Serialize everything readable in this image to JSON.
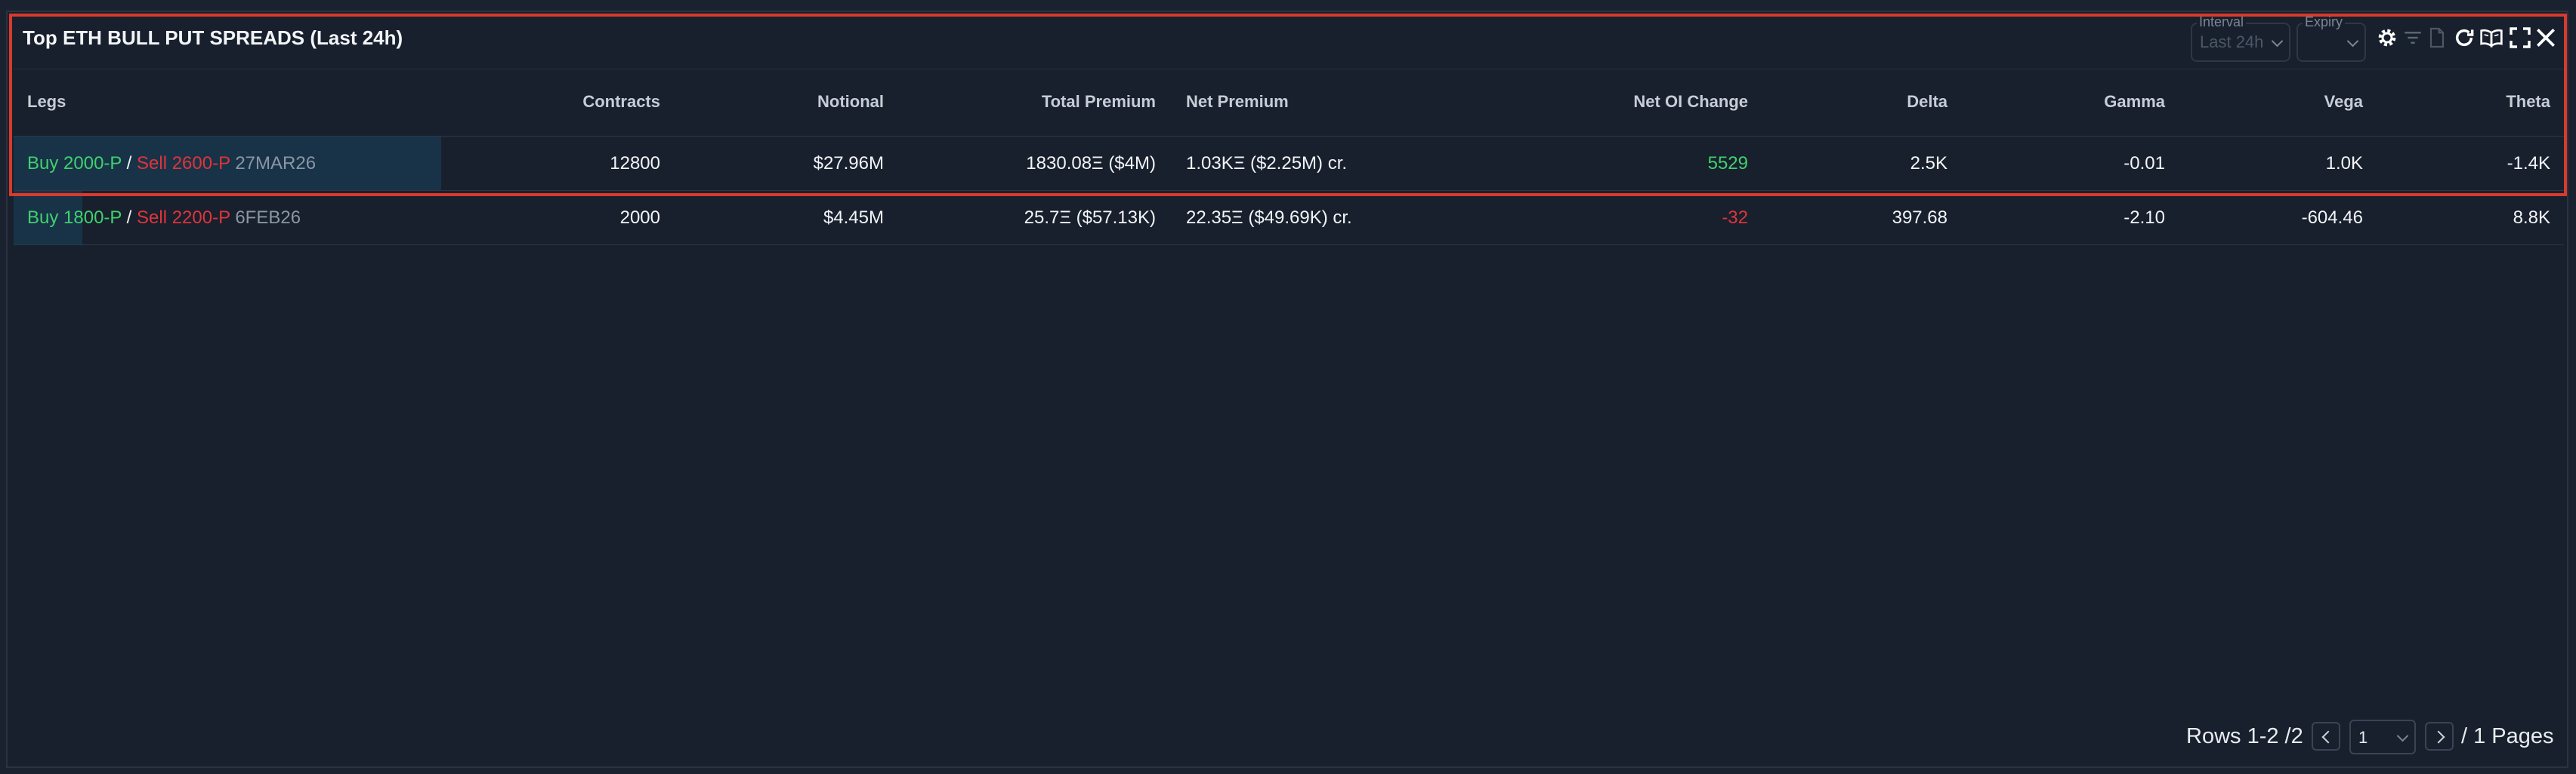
{
  "panel": {
    "title": "Top ETH BULL PUT SPREADS (Last 24h)"
  },
  "toolbar": {
    "interval": {
      "label": "Interval",
      "value": "Last 24h"
    },
    "expiry": {
      "label": "Expiry",
      "value": ""
    },
    "icons": [
      "gear-icon",
      "filter-icon",
      "document-icon",
      "refresh-icon",
      "book-icon",
      "fullscreen-icon",
      "close-icon"
    ]
  },
  "table": {
    "headers": {
      "legs": "Legs",
      "contracts": "Contracts",
      "notional": "Notional",
      "total_premium": "Total Premium",
      "net_premium": "Net Premium",
      "net_oi_change": "Net OI Change",
      "delta": "Delta",
      "gamma": "Gamma",
      "vega": "Vega",
      "theta": "Theta"
    },
    "rows": [
      {
        "buy": "Buy 2000-P",
        "sep": "/",
        "sell": "Sell 2600-P",
        "expiry": "27MAR26",
        "contracts": "12800",
        "notional": "$27.96M",
        "total_premium": "1830.08Ξ ($4M)",
        "net_premium": "1.03KΞ ($2.25M) cr.",
        "net_oi_change": "5529",
        "delta": "2.5K",
        "gamma": "-0.01",
        "vega": "1.0K",
        "theta": "-1.4K",
        "bar_fraction": 1.0
      },
      {
        "buy": "Buy 1800-P",
        "sep": "/",
        "sell": "Sell 2200-P",
        "expiry": "6FEB26",
        "contracts": "2000",
        "notional": "$4.45M",
        "total_premium": "25.7Ξ ($57.13K)",
        "net_premium": "22.35Ξ ($49.69K) cr.",
        "net_oi_change": "-32",
        "delta": "397.68",
        "gamma": "-2.10",
        "vega": "-604.46",
        "theta": "8.8K",
        "bar_fraction": 0.16
      }
    ]
  },
  "footer": {
    "rows_text": "Rows 1-2 /2",
    "page_value": "1",
    "pages_text": "/ 1 Pages"
  },
  "colors": {
    "background": "#18202d",
    "buy": "#3fd16d",
    "sell": "#e0343a",
    "highlight_border": "#d93a2b",
    "row_bar": "#183348"
  }
}
